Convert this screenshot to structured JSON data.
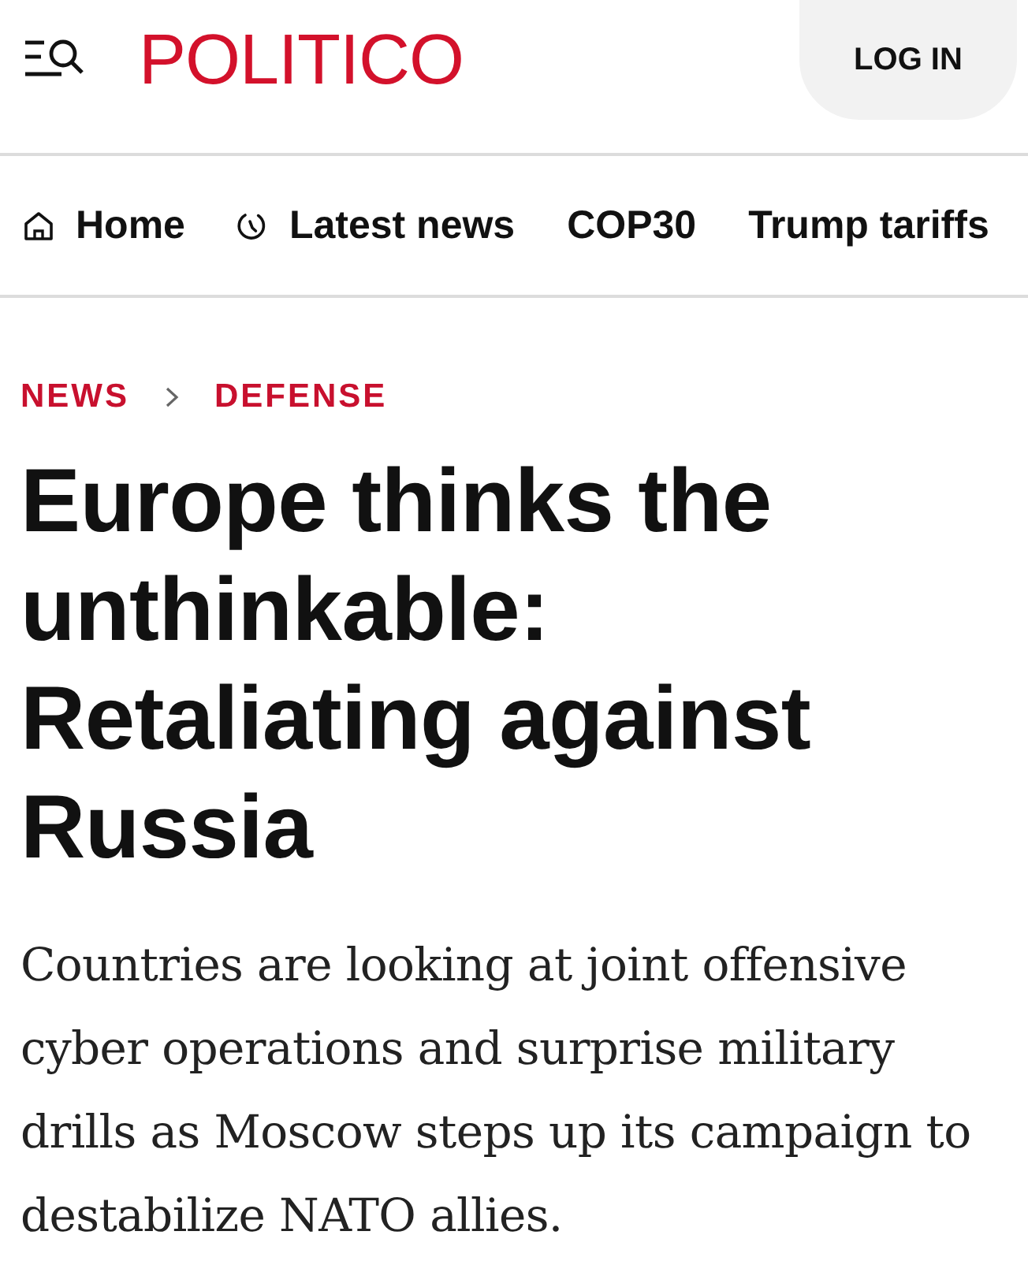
{
  "header": {
    "logo": "POLITICO",
    "login_button": "LOG IN"
  },
  "nav": {
    "items": [
      {
        "kind": "home",
        "label": "Home"
      },
      {
        "kind": "latest",
        "label": "Latest news"
      },
      {
        "kind": "plain",
        "label": "COP30"
      },
      {
        "kind": "plain",
        "label": "Trump tariffs"
      }
    ]
  },
  "breadcrumb": {
    "items": [
      "NEWS",
      "DEFENSE"
    ]
  },
  "article": {
    "headline": "Europe thinks the unthinkable: Retaliating against Russia",
    "dek": "Countries are looking at joint offensive cyber operations and surprise military drills as Moscow steps up its campaign to destabilize NATO allies."
  }
}
